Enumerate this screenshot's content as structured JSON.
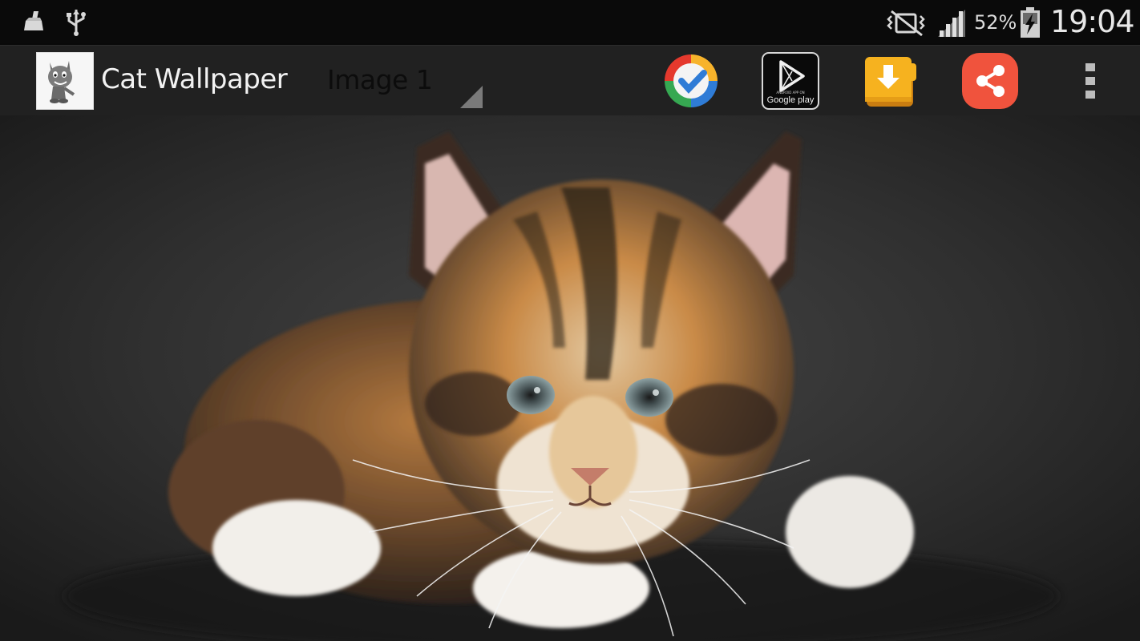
{
  "status_bar": {
    "icons": [
      "cleaner-icon",
      "usb-icon",
      "vibrate-mute-icon",
      "signal-icon",
      "battery-charging-icon"
    ],
    "battery": "52%",
    "time": "19:04"
  },
  "action_bar": {
    "title": "Cat Wallpaper",
    "spinner_value": "Image 1",
    "buttons": [
      "check-app-icon",
      "google-play-icon",
      "download-icon",
      "share-icon",
      "overflow-menu-icon"
    ],
    "google_play_label": "Google play",
    "google_play_sub": "ANDROID APP ON"
  },
  "wallpaper": {
    "subject": "kitten-photo",
    "colors": {
      "background": "#2e2e2e",
      "fur_orange": "#c98a47",
      "fur_dark": "#2a211b",
      "fur_white": "#f3f1ee"
    }
  }
}
